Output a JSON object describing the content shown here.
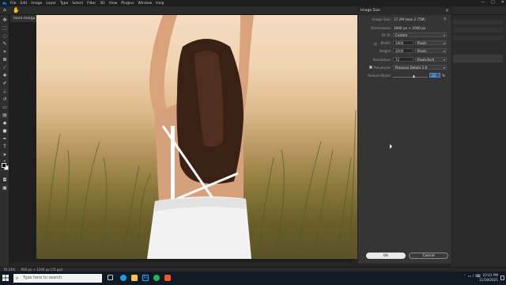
{
  "menubar": {
    "logo": "Ps",
    "items": [
      "File",
      "Edit",
      "Image",
      "Layer",
      "Type",
      "Select",
      "Filter",
      "3D",
      "View",
      "Plugins",
      "Window",
      "Help"
    ],
    "window_controls": [
      "—",
      "□",
      "✕"
    ]
  },
  "document": {
    "tab_label": "laura margu"
  },
  "dialog": {
    "title": "Image Size",
    "image_size_label": "Image Size:",
    "image_size_value": "17.2M (was 2.75M)",
    "dimensions_label": "Dimensions:",
    "dimensions_value": "3000 px × 2000 px",
    "fit_to_label": "Fit To:",
    "fit_to_value": "Custom",
    "width_label": "Width:",
    "width_value": "3000",
    "width_unit": "Pixels",
    "height_label": "Height:",
    "height_value": "2000",
    "height_unit": "Pixels",
    "resolution_label": "Resolution:",
    "resolution_value": "72",
    "resolution_unit": "Pixels/Inch",
    "resample_label": "Resample:",
    "resample_value": "Preserve Details 2.0",
    "resample_checked": true,
    "reduce_noise_label": "Reduce Noise:",
    "reduce_noise_value": "20",
    "reduce_noise_unit": "%",
    "reduce_noise_level_fraction": 0.6,
    "ok_label": "OK",
    "cancel_label": "Cancel"
  },
  "statusbar": {
    "zoom": "76.23%",
    "info": "900 px × 1200 px (72 ppi)"
  },
  "taskbar": {
    "search_placeholder": "Type here to search",
    "time": "10:01 PM",
    "date": "11/18/2021",
    "apps": [
      "task-view",
      "edge",
      "file-explorer",
      "photoshop",
      "spotify",
      "brave"
    ]
  },
  "colors": {
    "accent": "#31a8ff",
    "dialog_bg": "#353535",
    "taskbar_bg": "#0f1a24"
  }
}
